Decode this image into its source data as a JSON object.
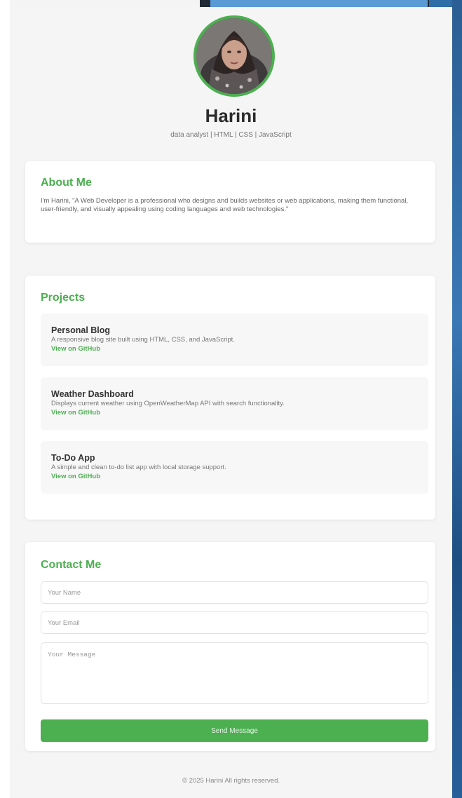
{
  "profile": {
    "name": "Harini",
    "tagline": "data analyst | HTML | CSS | JavaScript"
  },
  "about": {
    "title": "About Me",
    "text": "I'm Harini, \"A Web Developer is a professional who designs and builds websites or web applications, making them functional, user-friendly, and visually appealing using coding languages and web technologies.\""
  },
  "projects": {
    "title": "Projects",
    "items": [
      {
        "title": "Personal Blog",
        "description": "A responsive blog site built using HTML, CSS, and JavaScript.",
        "link": "View on GitHub"
      },
      {
        "title": "Weather Dashboard",
        "description": "Displays current weather using OpenWeatherMap API with search functionality.",
        "link": "View on GitHub"
      },
      {
        "title": "To-Do App",
        "description": "A simple and clean to-do list app with local storage support.",
        "link": "View on GitHub"
      }
    ]
  },
  "contact": {
    "title": "Contact Me",
    "name_placeholder": "Your Name",
    "email_placeholder": "Your Email",
    "message_placeholder": "Your Message",
    "send_label": "Send Message"
  },
  "footer": {
    "text": "© 2025 Harini All rights reserved."
  },
  "colors": {
    "accent": "#4caf50",
    "background": "#f5f5f5",
    "card": "#ffffff"
  },
  "icons": {
    "avatar": "profile-photo"
  }
}
